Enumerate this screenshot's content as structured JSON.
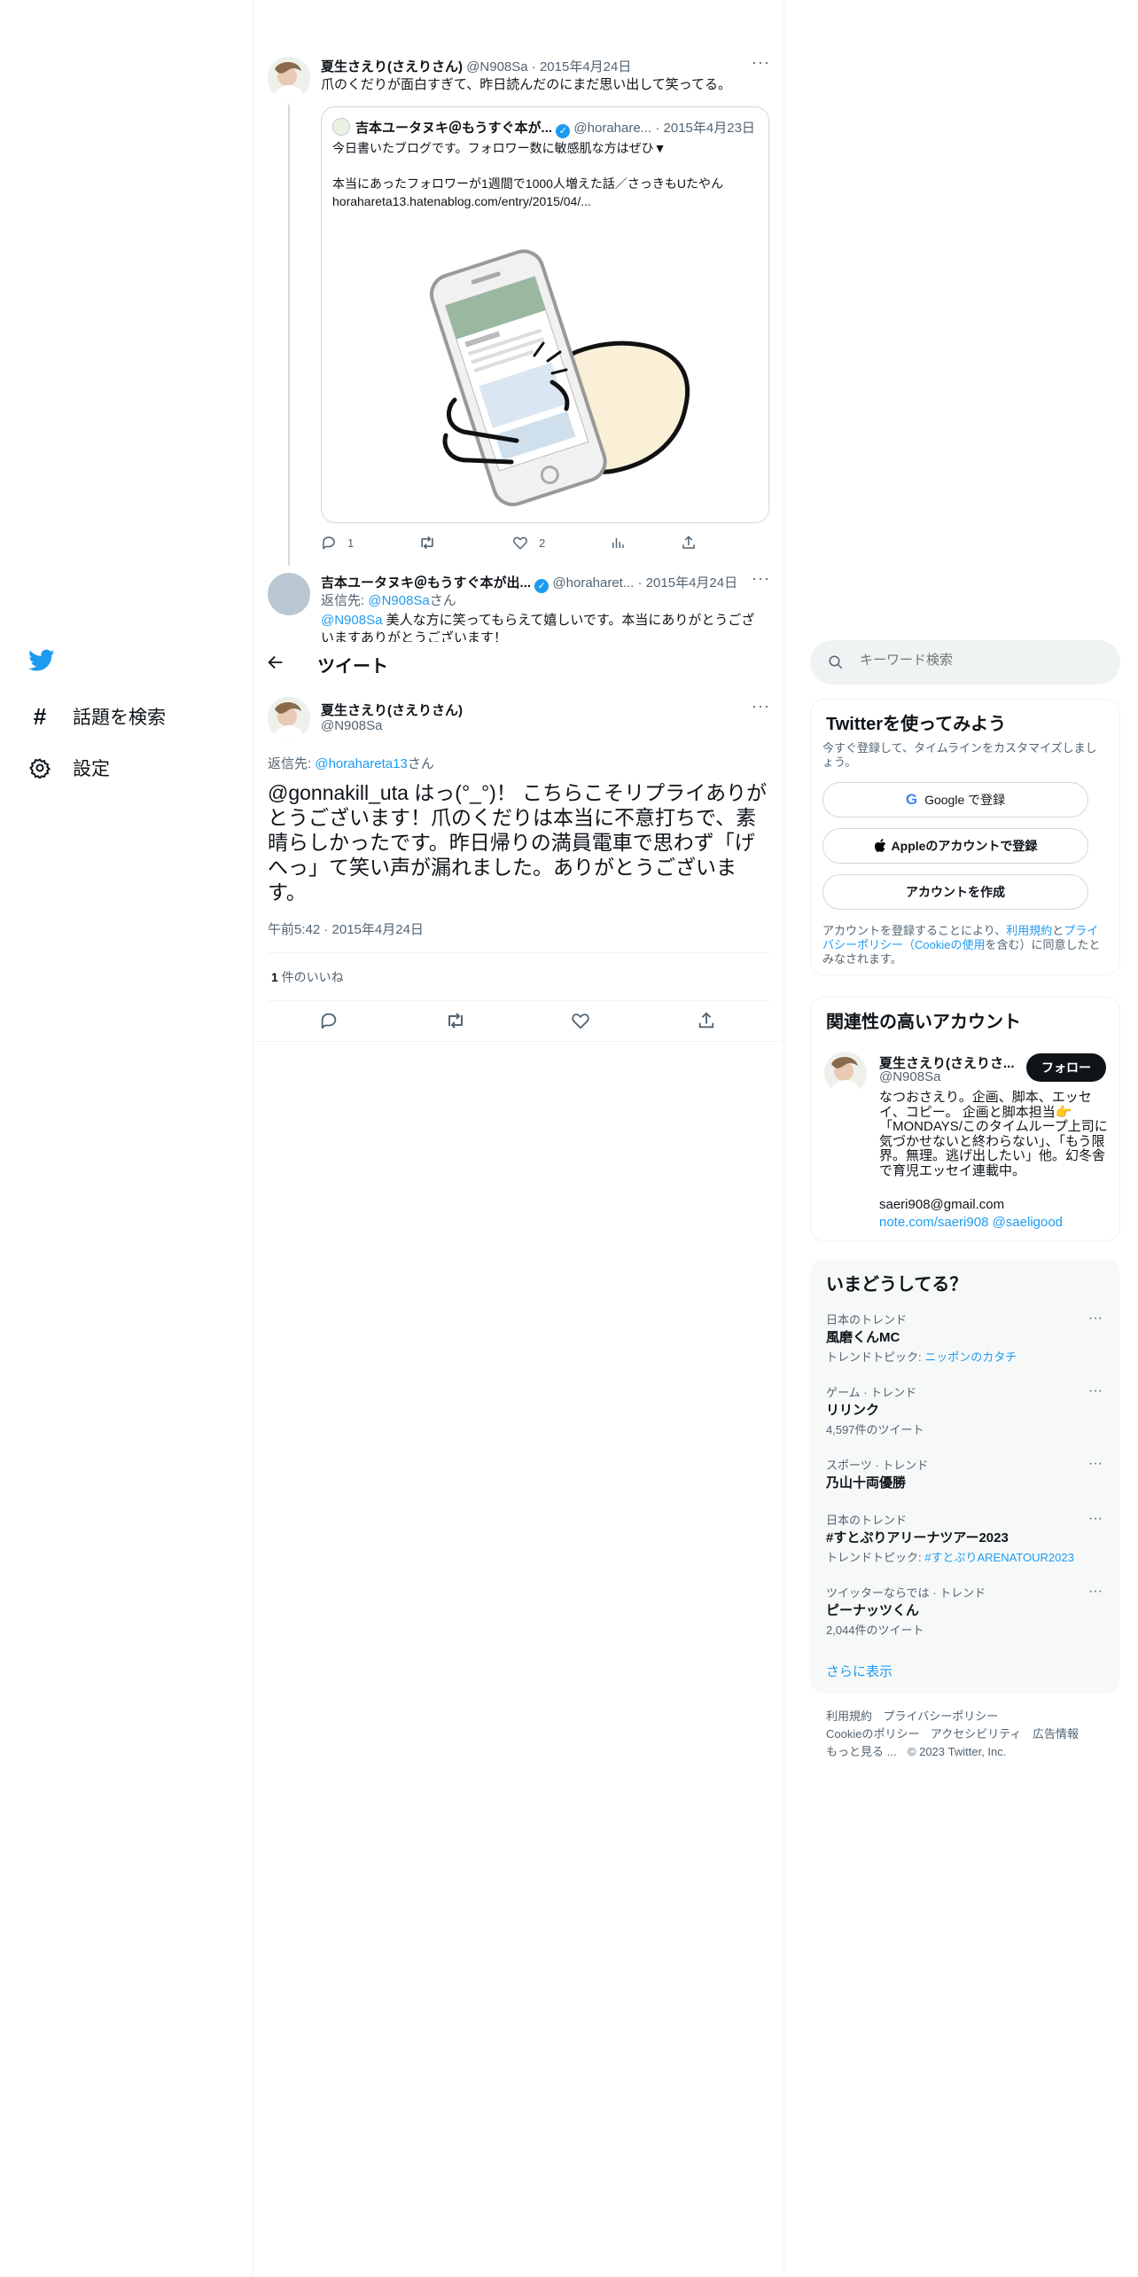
{
  "nav": {
    "explore_label": "話題を検索",
    "settings_label": "設定"
  },
  "colors": {
    "accent": "#1d9bf0",
    "text": "#0f1419",
    "muted": "#536471",
    "border": "#eff3f4",
    "verified": "#1d9bf0"
  },
  "tweet1": {
    "name": "夏生さえり(さえりさん)",
    "handle": "@N908Sa",
    "date": "2015年4月24日",
    "text": "爪のくだりが面白すぎて、昨日読んだのにまだ思い出して笑ってる。",
    "quote": {
      "name": "吉本ユータヌキ＠もうすぐ本が...",
      "handle": "@horahare...",
      "date": "2015年4月23日",
      "line1": "今日書いたブログです。フォロワー数に敏感肌な方はぜひ▼",
      "line2": "本当にあったフォロワーが1週間で1000人増えた話／さっきもUたやん",
      "line3": "horahareta13.hatenablog.com/entry/2015/04/..."
    },
    "reply_count": "1",
    "like_count": "2"
  },
  "tweet2": {
    "name": "吉本ユータヌキ＠もうすぐ本が出...",
    "handle": "@horaharet...",
    "date": "2015年4月24日",
    "reply_to_label": "返信先:",
    "reply_to_handle": "@N908Sa",
    "reply_to_suffix": "さん",
    "mention": "@N908Sa",
    "text": " 美人な方に笑ってもらえて嬉しいです。本当にありがとうござ",
    "text2": "いますありがとうございます！"
  },
  "header": {
    "title": "ツイート"
  },
  "main_tweet": {
    "name": "夏生さえり(さえりさん)",
    "handle": "@N908Sa",
    "reply_to_label": "返信先:",
    "reply_to_handle": "@horahareta13",
    "reply_to_suffix": "さん",
    "text": "@gonnakill_uta はっ(°_°)！ こちらこそリプライありがとうございます！爪のくだりは本当に不意打ちで、素晴らしかったです。昨日帰りの満員電車で思わず「げへっ」て笑い声が漏れました。ありがとうございます。",
    "timestamp": "午前5:42 · 2015年4月24日",
    "likes_count": "1",
    "likes_label": " 件のいいね"
  },
  "search": {
    "placeholder": "キーワード検索"
  },
  "signup": {
    "title": "Twitterを使ってみよう",
    "subtitle": "今すぐ登録して、タイムラインをカスタマイズしましょう。",
    "google_label": "Google で登録",
    "apple_label": "Appleのアカウントで登録",
    "create_label": "アカウントを作成",
    "legal_1": "アカウントを登録することにより、",
    "legal_terms": "利用規約",
    "legal_and": "と",
    "legal_privacy": "プライバシーポリシー（Cookieの使用",
    "legal_2": "を含む）に同意したとみなされます。"
  },
  "related": {
    "title": "関連性の高いアカウント",
    "name": "夏生さえり(さえりさ...",
    "handle": "@N908Sa",
    "follow_label": "フォロー",
    "bio": "なつおさえり。企画、脚本、エッセイ、コピー。 企画と脚本担当👉「MONDAYS/このタイムループ上司に気づかせないと終わらない」、「もう限界。無理。逃げ出したい」他。幻冬舎で育児エッセイ連載中。",
    "email": "saeri908@gmail.com",
    "link1": "note.com/saeri908",
    "link2": "@saeligood"
  },
  "trends": {
    "title": "いまどうしてる？",
    "items": [
      {
        "category": "日本のトレンド",
        "name": "風磨くんMC",
        "sub_label": "トレンドトピック: ",
        "sub_link": "ニッポンのカタチ"
      },
      {
        "category": "ゲーム · トレンド",
        "name": "リリンク",
        "sub_label": "4,597件のツイート",
        "sub_link": ""
      },
      {
        "category": "スポーツ · トレンド",
        "name": "乃山十両優勝",
        "sub_label": "",
        "sub_link": ""
      },
      {
        "category": "日本のトレンド",
        "name": "#すとぷりアリーナツアー2023",
        "sub_label": "トレンドトピック: ",
        "sub_link": "#すとぷりARENATOUR2023"
      },
      {
        "category": "ツイッターならでは · トレンド",
        "name": "ピーナッツくん",
        "sub_label": "2,044件のツイート",
        "sub_link": ""
      }
    ],
    "show_more": "さらに表示"
  },
  "footer": {
    "terms": "利用規約",
    "privacy": "プライバシーポリシー",
    "cookie": "Cookieのポリシー",
    "accessibility": "アクセシビリティ",
    "ads": "広告情報",
    "more": "もっと見る ...",
    "copyright": "© 2023 Twitter, Inc."
  }
}
